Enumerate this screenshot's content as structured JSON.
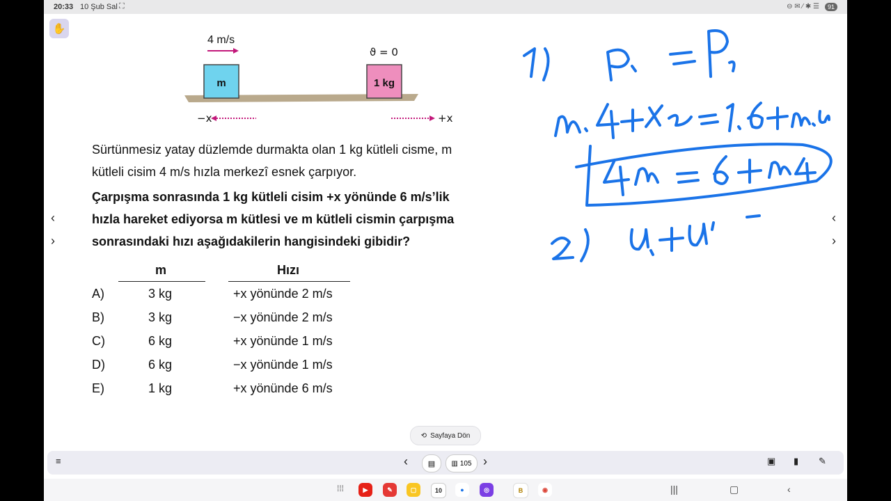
{
  "status": {
    "time": "20:33",
    "date": "10 Şub Sal",
    "battery": "91"
  },
  "diagram": {
    "velocity_m": "4 m/s",
    "velocity_1kg": "ϑ = 0",
    "block_m": "m",
    "block_1kg": "1 kg",
    "neg_x": "−x",
    "pos_x": "+x",
    "colors": {
      "block_m": "#6fd3ee",
      "block_1kg": "#ee8ebd",
      "arrow": "#c2187a",
      "surface": "#b9a98c"
    }
  },
  "question": {
    "para1_line1": "Sürtünmesiz yatay düzlemde durmakta olan 1 kg kütleli cisme, m",
    "para1_line2": "kütleli cisim 4 m/s hızla merkezî esnek çarpıyor.",
    "para2_line1": "Çarpışma sonrasında 1 kg kütleli cisim +x yönünde 6 m/s’lik",
    "para2_line2": "hızla hareket ediyorsa m kütlesi ve m kütleli cismin çarpışma",
    "para2_line3": "sonrasındaki hızı aşağıdakilerin hangisindeki gibidir?"
  },
  "answers": {
    "col_m": "m",
    "col_speed": "Hızı",
    "rows": [
      {
        "label": "A)",
        "m": "3 kg",
        "speed": "+x yönünde 2 m/s"
      },
      {
        "label": "B)",
        "m": "3 kg",
        "speed": "−x yönünde 2 m/s"
      },
      {
        "label": "C)",
        "m": "6 kg",
        "speed": "+x yönünde 1 m/s"
      },
      {
        "label": "D)",
        "m": "6 kg",
        "speed": "−x yönünde 1 m/s"
      },
      {
        "label": "E)",
        "m": "1 kg",
        "speed": "+x yönünde 6 m/s"
      }
    ]
  },
  "ink_color": "#1a73e8",
  "sayfaya_label": "Sayfaya Dön",
  "toolbar": {
    "page_number": "105"
  },
  "dock": {
    "calendar_day": "10"
  },
  "nav": {
    "prev": "‹",
    "next": "›"
  }
}
